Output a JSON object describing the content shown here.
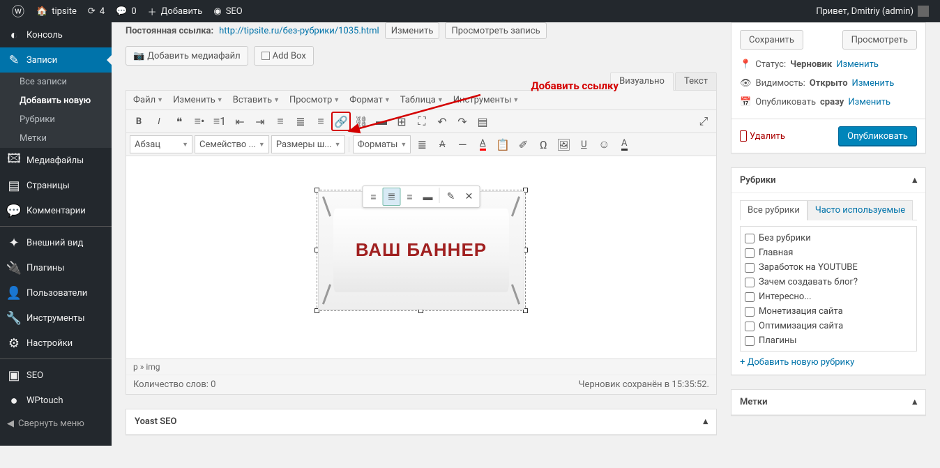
{
  "adminbar": {
    "site": "tipsite",
    "updates": "4",
    "comments": "0",
    "add": "Добавить",
    "seo": "SEO",
    "greeting": "Привет, Dmitriy (admin)"
  },
  "sidebar": {
    "items": [
      {
        "icon": "◐",
        "label": "Консоль"
      },
      {
        "icon": "✎",
        "label": "Записи",
        "current": true,
        "sub": [
          {
            "label": "Все записи"
          },
          {
            "label": "Добавить новую",
            "active": true
          },
          {
            "label": "Рубрики"
          },
          {
            "label": "Метки"
          }
        ]
      },
      {
        "icon": "🖾",
        "label": "Медиафайлы"
      },
      {
        "icon": "▤",
        "label": "Страницы"
      },
      {
        "icon": "💬",
        "label": "Комментарии"
      },
      {
        "sep": true
      },
      {
        "icon": "✦",
        "label": "Внешний вид"
      },
      {
        "icon": "🔌",
        "label": "Плагины"
      },
      {
        "icon": "👤",
        "label": "Пользователи"
      },
      {
        "icon": "🔧",
        "label": "Инструменты"
      },
      {
        "icon": "⚙",
        "label": "Настройки"
      },
      {
        "sep": true
      },
      {
        "icon": "▣",
        "label": "SEO"
      },
      {
        "icon": "●",
        "label": "WPtouch"
      }
    ],
    "collapse": "Свернуть меню"
  },
  "permalink": {
    "label": "Постоянная ссылка:",
    "url": "http://tipsite.ru/без-рубрики/1035.html",
    "edit": "Изменить",
    "view": "Просмотреть запись"
  },
  "mediaButtons": {
    "add": "Добавить медиафайл",
    "box": "Add Box"
  },
  "editorTabs": {
    "visual": "Визуально",
    "text": "Текст"
  },
  "menubar": [
    "Файл",
    "Изменить",
    "Вставить",
    "Просмотр",
    "Формат",
    "Таблица",
    "Инструменты"
  ],
  "annotation": "Добавить ссылку",
  "toolbar2": {
    "paragraph": "Абзац",
    "fontfamily": "Семейство ...",
    "fontsize": "Размеры ш...",
    "formats": "Форматы"
  },
  "bannerText": "ВАШ БАННЕР",
  "editorStatus": {
    "path": "p » img"
  },
  "editorFooter": {
    "words": "Количество слов: 0",
    "saved": "Черновик сохранён в 15:35:52."
  },
  "yoast": {
    "title": "Yoast SEO"
  },
  "publish": {
    "save": "Сохранить",
    "preview": "Просмотреть",
    "status_label": "Статус:",
    "status_val": "Черновик",
    "status_edit": "Изменить",
    "vis_label": "Видимость:",
    "vis_val": "Открыто",
    "vis_edit": "Изменить",
    "pub_label": "Опубликовать",
    "pub_val": "сразу",
    "pub_edit": "Изменить",
    "trash": "Удалить",
    "publish_btn": "Опубликовать"
  },
  "categories": {
    "title": "Рубрики",
    "tabs": {
      "all": "Все рубрики",
      "popular": "Часто используемые"
    },
    "items": [
      "Без рубрики",
      "Главная",
      "Заработок на YOUTUBE",
      "Зачем создавать блог?",
      "Интересно...",
      "Монетизация сайта",
      "Оптимизация сайта",
      "Плагины"
    ],
    "add": "+ Добавить новую рубрику"
  },
  "tags": {
    "title": "Метки"
  }
}
